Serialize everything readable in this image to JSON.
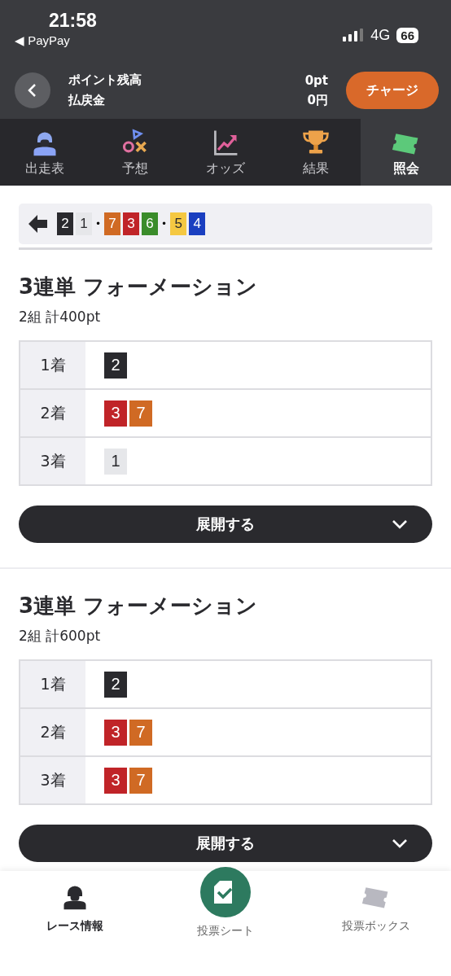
{
  "status_bar": {
    "time": "21:58",
    "back_app": "◀ PayPay",
    "network": "4G",
    "battery": "66"
  },
  "header": {
    "labels": [
      "ポイント残高",
      "払戻金"
    ],
    "values": [
      "0pt",
      "0円"
    ],
    "charge_button": "チャージ"
  },
  "tabs": [
    {
      "label": "出走表",
      "selected": false
    },
    {
      "label": "予想",
      "selected": false
    },
    {
      "label": "オッズ",
      "selected": false
    },
    {
      "label": "結果",
      "selected": false
    },
    {
      "label": "照会",
      "selected": true
    }
  ],
  "combination": [
    {
      "kind": "chip",
      "text": "2",
      "color": "#2a2a2e"
    },
    {
      "kind": "chip",
      "text": "1",
      "color": "#e6e7ea"
    },
    {
      "kind": "sep",
      "text": "•"
    },
    {
      "kind": "chip",
      "text": "7",
      "color": "#d06a24"
    },
    {
      "kind": "chip",
      "text": "3",
      "color": "#c02428"
    },
    {
      "kind": "chip",
      "text": "6",
      "color": "#3a8c2a"
    },
    {
      "kind": "sep",
      "text": "•"
    },
    {
      "kind": "chip",
      "text": "5",
      "color": "#f5c842"
    },
    {
      "kind": "chip",
      "text": "4",
      "color": "#1a3fc0"
    }
  ],
  "bets": [
    {
      "title": "3連単 フォーメーション",
      "summary": "2組 計400pt",
      "expand_button": "展開する",
      "rows": [
        {
          "place": "1着",
          "chips": [
            {
              "text": "2",
              "color": "#2a2a2e"
            }
          ]
        },
        {
          "place": "2着",
          "chips": [
            {
              "text": "3",
              "color": "#c02428"
            },
            {
              "text": "7",
              "color": "#d06a24"
            }
          ]
        },
        {
          "place": "3着",
          "chips": [
            {
              "text": "1",
              "color": "#e6e7ea"
            }
          ]
        }
      ]
    },
    {
      "title": "3連単 フォーメーション",
      "summary": "2組 計600pt",
      "expand_button": "展開する",
      "rows": [
        {
          "place": "1着",
          "chips": [
            {
              "text": "2",
              "color": "#2a2a2e"
            }
          ]
        },
        {
          "place": "2着",
          "chips": [
            {
              "text": "3",
              "color": "#c02428"
            },
            {
              "text": "7",
              "color": "#d06a24"
            }
          ]
        },
        {
          "place": "3着",
          "chips": [
            {
              "text": "3",
              "color": "#c02428"
            },
            {
              "text": "7",
              "color": "#d06a24"
            }
          ]
        }
      ]
    }
  ],
  "bottom_nav": [
    {
      "label": "レース情報",
      "selected": true
    },
    {
      "label": "投票シート",
      "selected": false
    },
    {
      "label": "投票ボックス",
      "selected": false
    }
  ]
}
